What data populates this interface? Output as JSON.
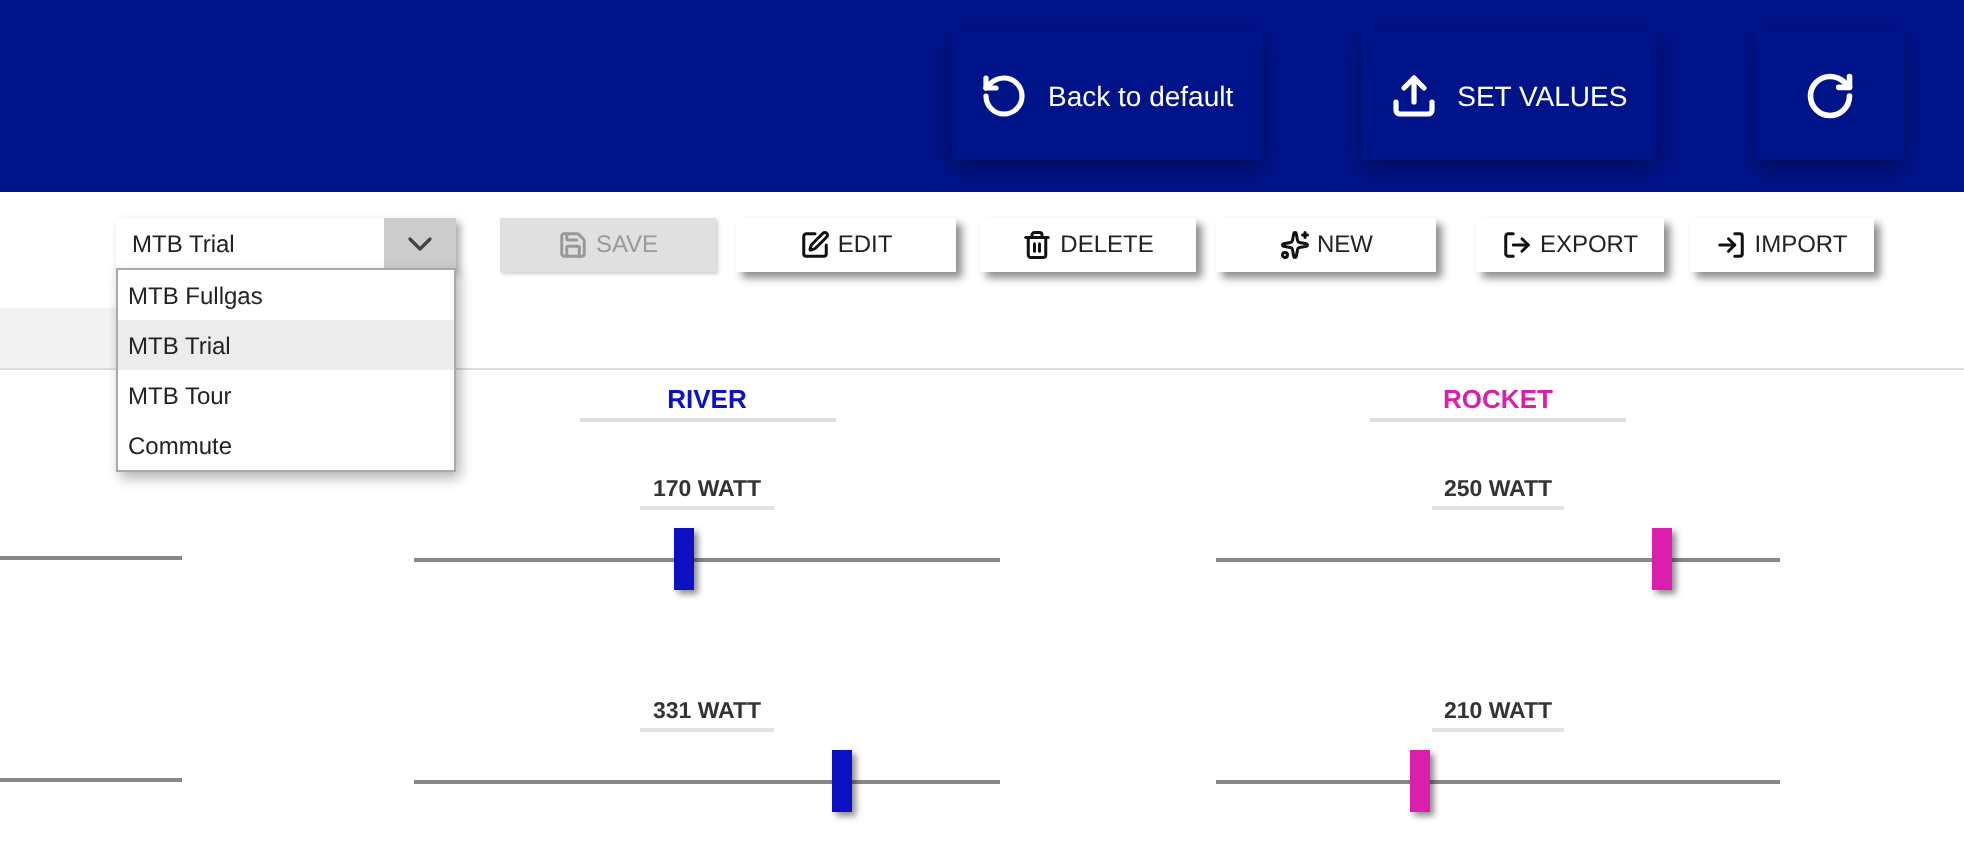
{
  "header": {
    "buttons": [
      {
        "kind": "reset",
        "label": "Back to default"
      },
      {
        "kind": "upload",
        "label": "SET VALUES"
      },
      {
        "kind": "refresh"
      }
    ]
  },
  "toolbar": {
    "profile_select": {
      "value": "MTB Trial",
      "options": [
        {
          "label": "MTB Fullgas",
          "selected": false
        },
        {
          "label": "MTB Trial",
          "selected": true
        },
        {
          "label": "MTB Tour",
          "selected": false
        },
        {
          "label": "Commute",
          "selected": false
        }
      ]
    },
    "buttons": [
      {
        "kind": "save",
        "label": "SAVE",
        "disabled": true
      },
      {
        "kind": "edit",
        "label": "EDIT",
        "disabled": false
      },
      {
        "kind": "delete",
        "label": "DELETE",
        "disabled": false
      },
      {
        "kind": "new",
        "label": "NEW",
        "disabled": false
      },
      {
        "kind": "export",
        "label": "EXPORT",
        "disabled": false
      },
      {
        "kind": "import",
        "label": "IMPORT",
        "disabled": false
      }
    ]
  },
  "columns": [
    {
      "name": "RIVER",
      "color": "#0c12c4",
      "sliders": [
        {
          "reading": "170 WATT",
          "level": 0.46
        },
        {
          "reading": "331 WATT",
          "level": 0.73
        }
      ]
    },
    {
      "name": "ROCKET",
      "color": "#dc1eac",
      "sliders": [
        {
          "reading": "250 WATT",
          "level": 0.79
        },
        {
          "reading": "210 WATT",
          "level": 0.36
        }
      ]
    }
  ]
}
